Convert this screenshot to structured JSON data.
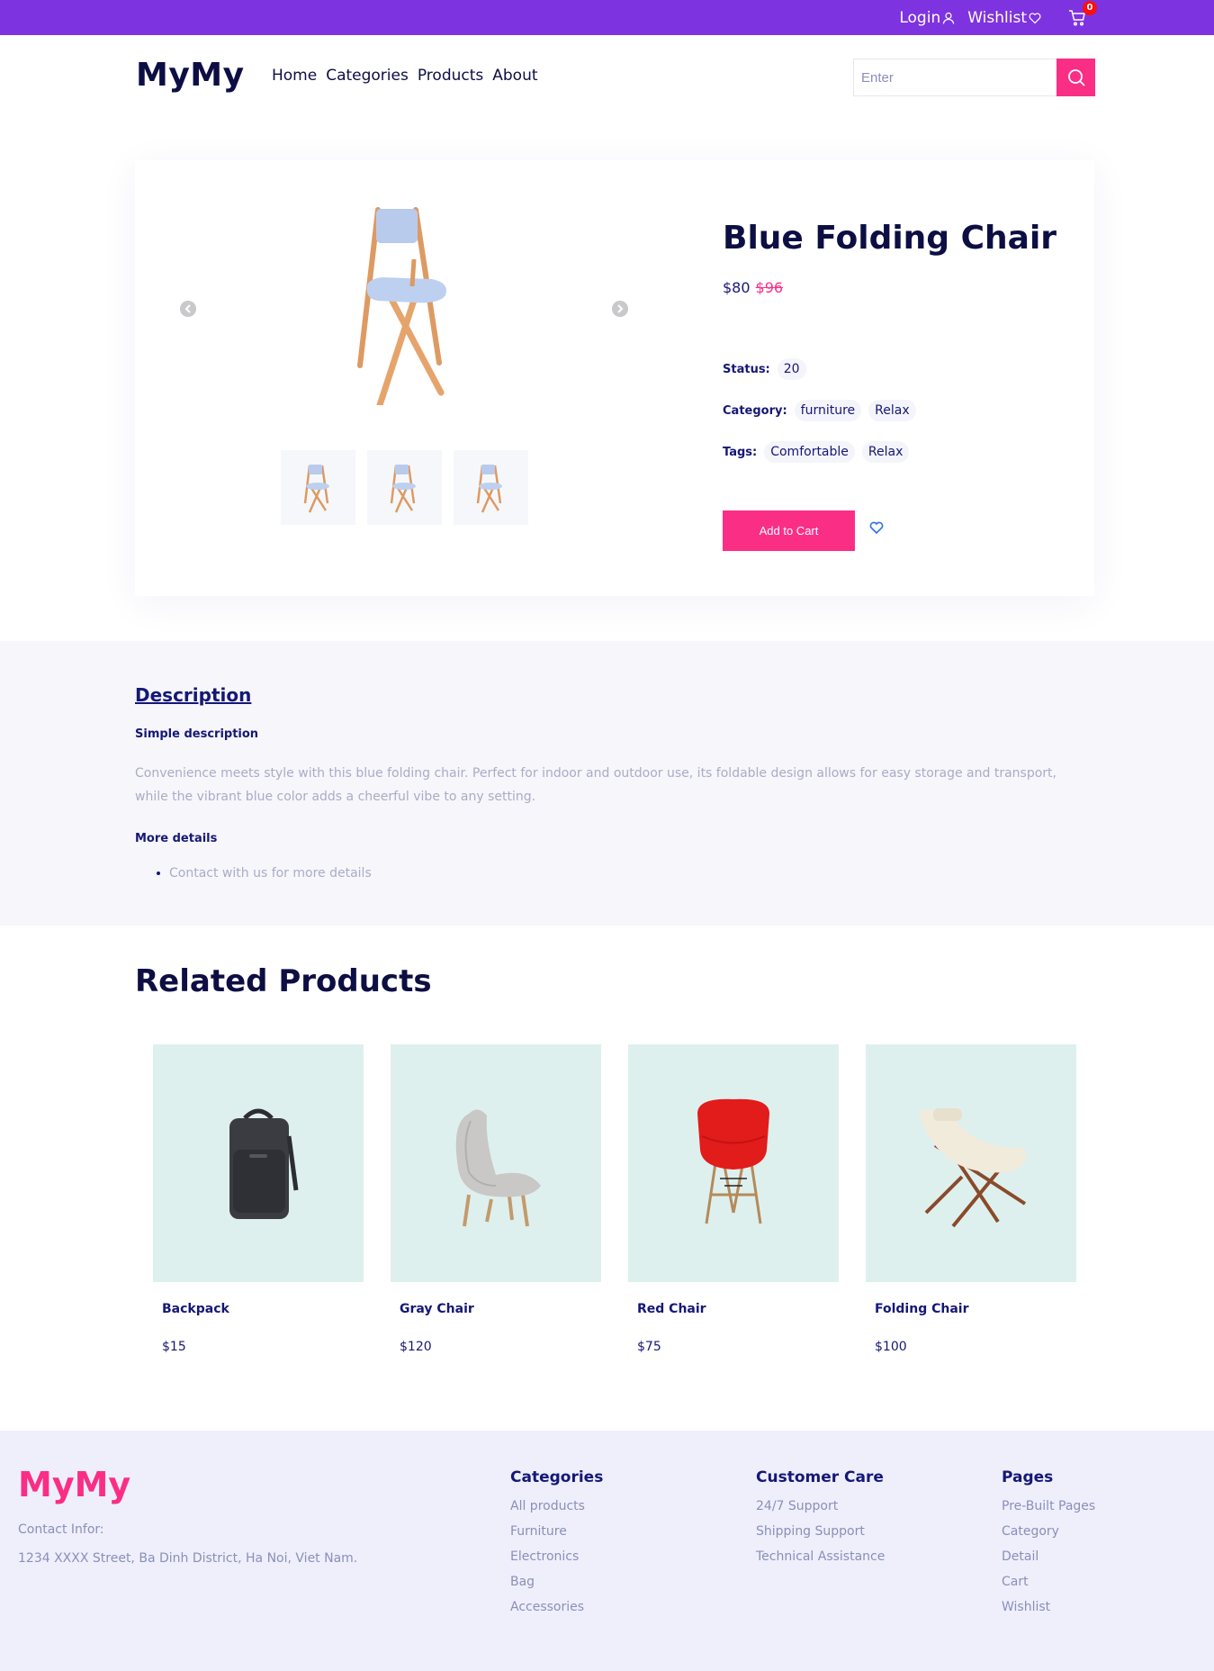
{
  "topbar": {
    "login": "Login",
    "wishlist": "Wishlist",
    "cart_count": "0"
  },
  "header": {
    "logo": "MyMy",
    "nav": [
      "Home",
      "Categories",
      "Products",
      "About"
    ],
    "search_placeholder": "Enter"
  },
  "product": {
    "title": "Blue Folding Chair",
    "price": "$80",
    "old_price": "$96",
    "status_label": "Status:",
    "status_value": "20",
    "category_label": "Category:",
    "categories": [
      "furniture",
      "Relax"
    ],
    "tags_label": "Tags:",
    "tags": [
      "Comfortable",
      "Relax"
    ],
    "add_to_cart": "Add to Cart"
  },
  "description": {
    "title": "Description",
    "subtitle": "Simple description",
    "text": "Convenience meets style with this blue folding chair. Perfect for indoor and outdoor use, its foldable design allows for easy storage and transport, while the vibrant blue color adds a cheerful vibe to any setting.",
    "more_title": "More details",
    "bullets": [
      "Contact with us for more details"
    ]
  },
  "related": {
    "title": "Related Products",
    "items": [
      {
        "name": "Backpack",
        "price": "$15",
        "icon": "backpack"
      },
      {
        "name": "Gray Chair",
        "price": "$120",
        "icon": "gray-chair"
      },
      {
        "name": "Red Chair",
        "price": "$75",
        "icon": "red-chair"
      },
      {
        "name": "Folding Chair",
        "price": "$100",
        "icon": "folding-chair"
      }
    ]
  },
  "footer": {
    "logo": "MyMy",
    "contact_label": "Contact Infor:",
    "address": "1234 XXXX Street, Ba Dinh District, Ha Noi, Viet Nam.",
    "columns": [
      {
        "title": "Categories",
        "items": [
          "All products",
          "Furniture",
          "Electronics",
          "Bag",
          "Accessories"
        ]
      },
      {
        "title": "Customer Care",
        "items": [
          "24/7 Support",
          "Shipping Support",
          "Technical Assistance"
        ]
      },
      {
        "title": "Pages",
        "items": [
          "Pre-Built Pages",
          "Category",
          "Detail",
          "Cart",
          "Wishlist"
        ]
      }
    ]
  },
  "colors": {
    "topbar": "#7e33e0",
    "accent": "#fb2e86",
    "navy": "#151875",
    "product_bg": "#def0ee"
  }
}
